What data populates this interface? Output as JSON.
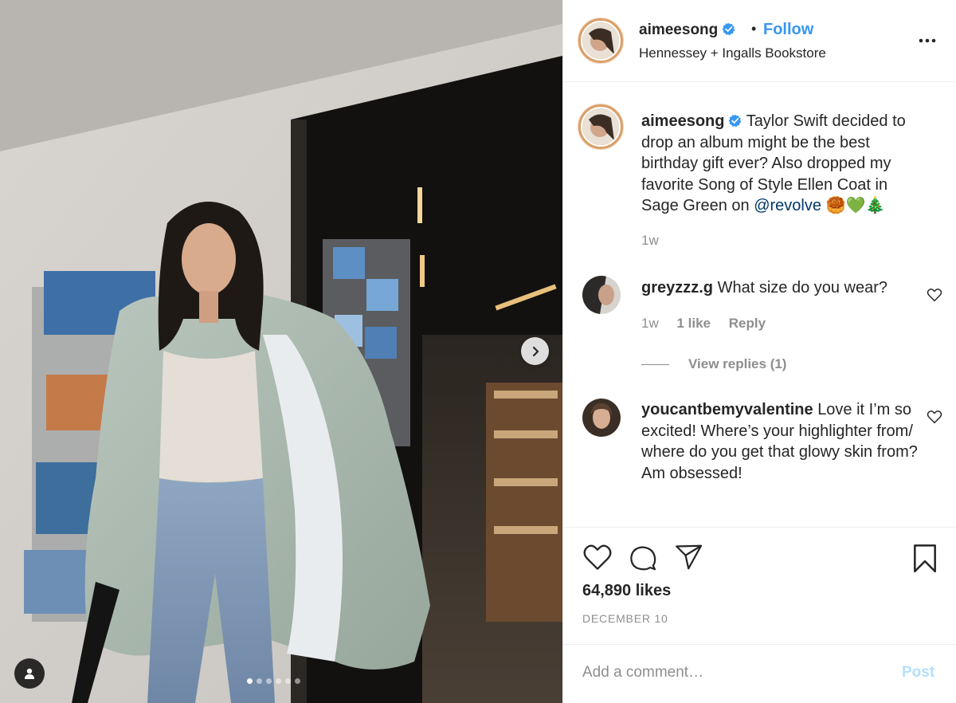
{
  "post": {
    "username": "aimeesong",
    "follow_separator": "•",
    "follow_label": "Follow",
    "location": "Hennessey + Ingalls Bookstore",
    "caption": {
      "username": "aimeesong",
      "text": "Taylor Swift decided to drop an album might be the best birthday gift ever? Also dropped my favorite Song of Style Ellen Coat in Sage Green on",
      "mention": "@revolve",
      "emojis": "🥮💚🎄",
      "time": "1w"
    },
    "comments": [
      {
        "username": "greyzzz.g",
        "text": "What size do you wear?",
        "time": "1w",
        "likes": "1 like",
        "reply_label": "Reply",
        "view_replies": "View replies (1)"
      },
      {
        "username": "youcantbemyvalentine",
        "text": "Love it I’m so excited! Where’s your highlighter from/ where do you get that glowy skin from? Am obsessed!"
      }
    ],
    "likes": "64,890 likes",
    "date": "DECEMBER 10",
    "add_comment_placeholder": "Add a comment…",
    "post_label": "Post",
    "carousel": {
      "count": 6,
      "active": 0
    }
  },
  "icons": {
    "verified": "verified-badge-icon",
    "more": "more-options-icon",
    "heart": "heart-icon",
    "comment": "comment-icon",
    "share": "share-icon",
    "save": "bookmark-icon",
    "next": "chevron-right-icon",
    "tag": "user-tag-icon"
  },
  "colors": {
    "link": "#3897f0",
    "mention": "#00376b",
    "muted": "#8e8e8e",
    "post_disabled": "#b2dffc",
    "text": "#262626"
  }
}
